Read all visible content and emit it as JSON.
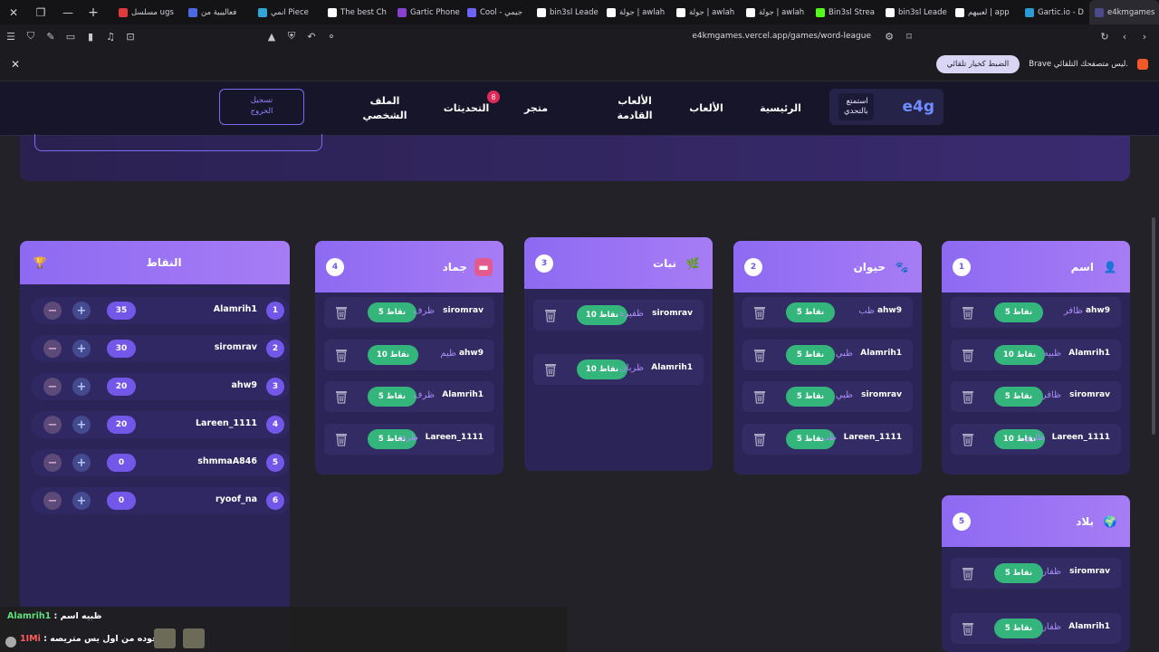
{
  "browser": {
    "tabs": [
      {
        "label": "e4kmgames",
        "color": "#4b4a8a",
        "active": true
      },
      {
        "label": "Gartic.io - D",
        "color": "#2a9bd6",
        "active": false
      },
      {
        "label": "لعبيهم | app",
        "color": "#ffffff",
        "active": false
      },
      {
        "label": "bin3sl Leade",
        "color": "#ffffff",
        "active": false
      },
      {
        "label": "Bin3sl Strea",
        "color": "#53fc18",
        "active": false
      },
      {
        "label": "جولة | awlah",
        "color": "#ffffff",
        "active": false
      },
      {
        "label": "جولة | awlah",
        "color": "#ffffff",
        "active": false
      },
      {
        "label": "جولة | awlah",
        "color": "#ffffff",
        "active": false
      },
      {
        "label": "bin3sl Leade",
        "color": "#ffffff",
        "active": false
      },
      {
        "label": "Cool - جيمي",
        "color": "#6b64f5",
        "active": false
      },
      {
        "label": "Gartic Phone",
        "color": "#8a3fcf",
        "active": false
      },
      {
        "label": "The best Ch",
        "color": "#ffffff",
        "active": false
      },
      {
        "label": "انمي Piece",
        "color": "#30a6d8",
        "active": false
      },
      {
        "label": "فعاليبية من",
        "color": "#4b6ae0",
        "active": false
      },
      {
        "label": "مسلسل ugs",
        "color": "#e03a3a",
        "active": false
      }
    ],
    "url": "e4kmgames.vercel.app/games/word-league",
    "infobar_message": "Brave ليس متصفحك التلقائي.",
    "infobar_button": "الضبط كخيار تلقائي"
  },
  "nav": {
    "brand": "e4g",
    "tagline_1": "استمتع",
    "tagline_2": "بالتحدي",
    "home": "الرئيسية",
    "games": "الألعاب",
    "upcoming_1": "الألعاب",
    "upcoming_2": "القادمة",
    "store": "متجر",
    "updates": "التحديثات",
    "updates_badge": "8",
    "profile_1": "الملف",
    "profile_2": "الشخصي",
    "logout_1": "تسجيل",
    "logout_2": "الخروج"
  },
  "columns": [
    {
      "num": "1",
      "title": "اسم",
      "icon": "person-icon",
      "entries": [
        {
          "user": "ahw9",
          "word": "ظافر",
          "points": "5 نقاط"
        },
        {
          "user": "Alamrih1",
          "word": "ظبيه",
          "points": "10 نقاط"
        },
        {
          "user": "siromrav",
          "word": "ظافر",
          "points": "5 نقاط"
        },
        {
          "user": "Lareen_1111",
          "word": "ظاري",
          "points": "10 نقاط"
        }
      ]
    },
    {
      "num": "2",
      "title": "حيوان",
      "icon": "paw-icon",
      "entries": [
        {
          "user": "ahw9",
          "word": "ظب",
          "points": "5 نقاط"
        },
        {
          "user": "Alamrih1",
          "word": "ظبي",
          "points": "5 نقاط"
        },
        {
          "user": "siromrav",
          "word": "ظبي",
          "points": "5 نقاط"
        },
        {
          "user": "Lareen_1111",
          "word": "ظب",
          "points": "5 نقاط"
        }
      ]
    },
    {
      "num": "3",
      "title": "نبات",
      "icon": "leaf-icon",
      "entries": [
        {
          "user": "siromrav",
          "word": "ظفيرة",
          "points": "10 نقاط"
        },
        {
          "user": "Alamrih1",
          "word": "ظربان",
          "points": "10 نقاط"
        }
      ]
    },
    {
      "num": "4",
      "title": "جماد",
      "icon": "box-icon",
      "entries": [
        {
          "user": "siromrav",
          "word": "ظرف",
          "points": "5 نقاط"
        },
        {
          "user": "ahw9",
          "word": "ظيم",
          "points": "10 نقاط"
        },
        {
          "user": "Alamrih1",
          "word": "ظرف",
          "points": "5 نقاط"
        },
        {
          "user": "Lareen_1111",
          "word": "ظرف",
          "points": "5 نقاط"
        }
      ]
    },
    {
      "num": "5",
      "title": "بلاد",
      "icon": "globe-icon",
      "entries": [
        {
          "user": "siromrav",
          "word": "ظفار",
          "points": "5 نقاط"
        },
        {
          "user": "Alamrih1",
          "word": "ظفار",
          "points": "5 نقاط"
        }
      ]
    }
  ],
  "scores": {
    "title": "النقاط",
    "rows": [
      {
        "rank": "1",
        "name": "Alamrih1",
        "score": "35"
      },
      {
        "rank": "2",
        "name": "siromrav",
        "score": "30"
      },
      {
        "rank": "3",
        "name": "ahw9",
        "score": "20"
      },
      {
        "rank": "4",
        "name": "Lareen_1111",
        "score": "20"
      },
      {
        "rank": "5",
        "name": "shmmaA846",
        "score": "0"
      },
      {
        "rank": "6",
        "name": "ryoof_na",
        "score": "0"
      }
    ]
  },
  "chat": {
    "line1_user": "Alamrih1",
    "line1_text": ": ظبيه اسم",
    "line2_user": "1IMi",
    "line2_text": ": موجوده من اول يس متريصه"
  },
  "colors": {
    "accent": "#8d6af2",
    "points_pill": "#34b57c",
    "panel": "#2a2457"
  }
}
